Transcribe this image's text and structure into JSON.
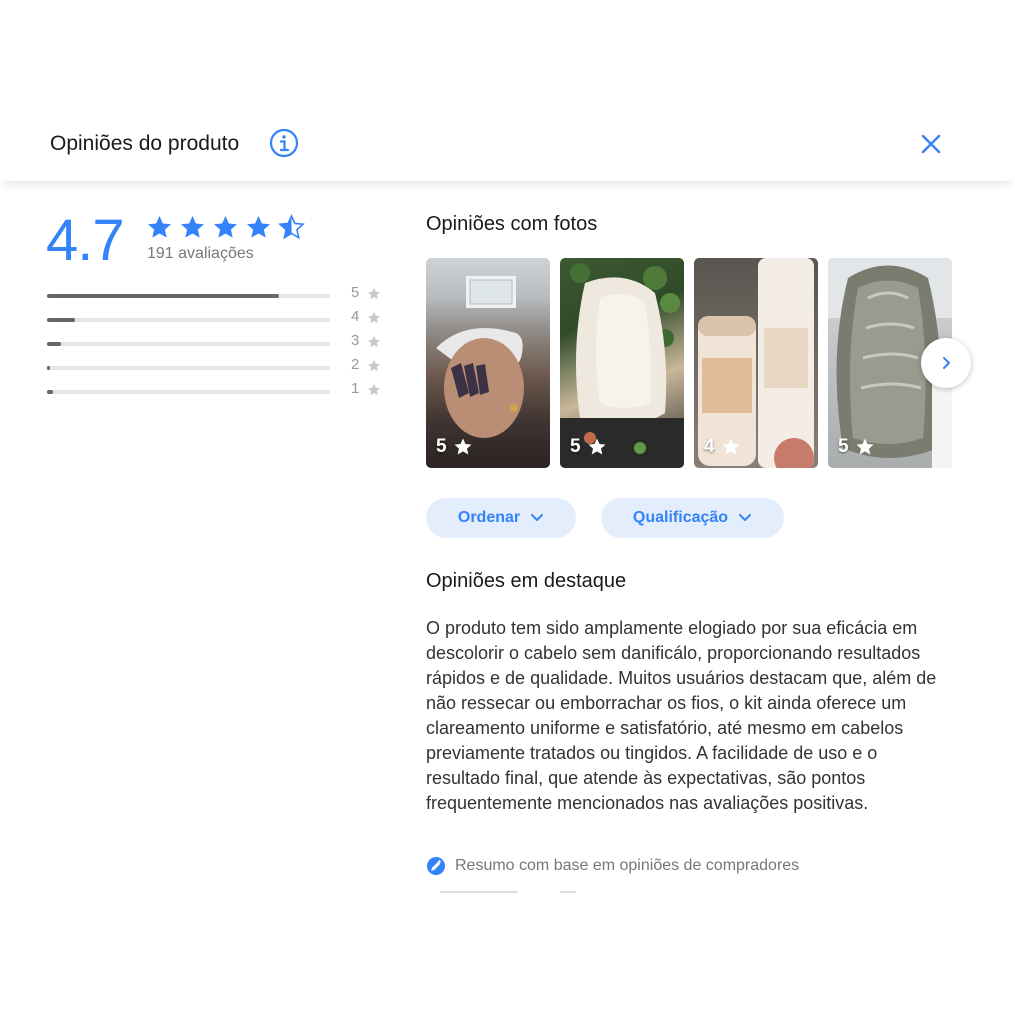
{
  "header": {
    "title": "Opiniões do produto",
    "info_icon": "info-circle-icon",
    "close_icon": "close-icon"
  },
  "summary_rating": {
    "average": "4.7",
    "stars": 4.7,
    "count_text": "191 avaliações",
    "distribution": [
      {
        "stars": "5",
        "fraction": 0.82
      },
      {
        "stars": "4",
        "fraction": 0.1
      },
      {
        "stars": "3",
        "fraction": 0.05
      },
      {
        "stars": "2",
        "fraction": 0.01
      },
      {
        "stars": "1",
        "fraction": 0.02
      }
    ]
  },
  "photos_section": {
    "title": "Opiniões com fotos",
    "photos": [
      {
        "rating": "5"
      },
      {
        "rating": "5"
      },
      {
        "rating": "4"
      },
      {
        "rating": "5"
      }
    ],
    "next_icon": "chevron-right-icon"
  },
  "filters": {
    "sort_label": "Ordenar",
    "rating_label": "Qualificação"
  },
  "highlights": {
    "title": "Opiniões em destaque",
    "summary_text": "O produto tem sido amplamente elogiado por sua eficácia em descolorir o cabelo sem danificálo, proporcionando resultados rápidos e de qualidade. Muitos usuários destacam que, além de não ressecar ou emborrachar os fios, o kit ainda oferece um clareamento uniforme e satisfatório, até mesmo em cabelos previamente tratados ou tingidos. A facilidade de uso e o resultado final, que atende às expectativas, são pontos frequentemente mencionados nas avaliações positivas.",
    "ai_note": "Resumo com base em opiniões de compradores"
  },
  "colors": {
    "accent": "#3483fa",
    "pill_bg": "#e3edfb",
    "bar_fill": "#666666",
    "bar_track": "#e6e6e6"
  }
}
